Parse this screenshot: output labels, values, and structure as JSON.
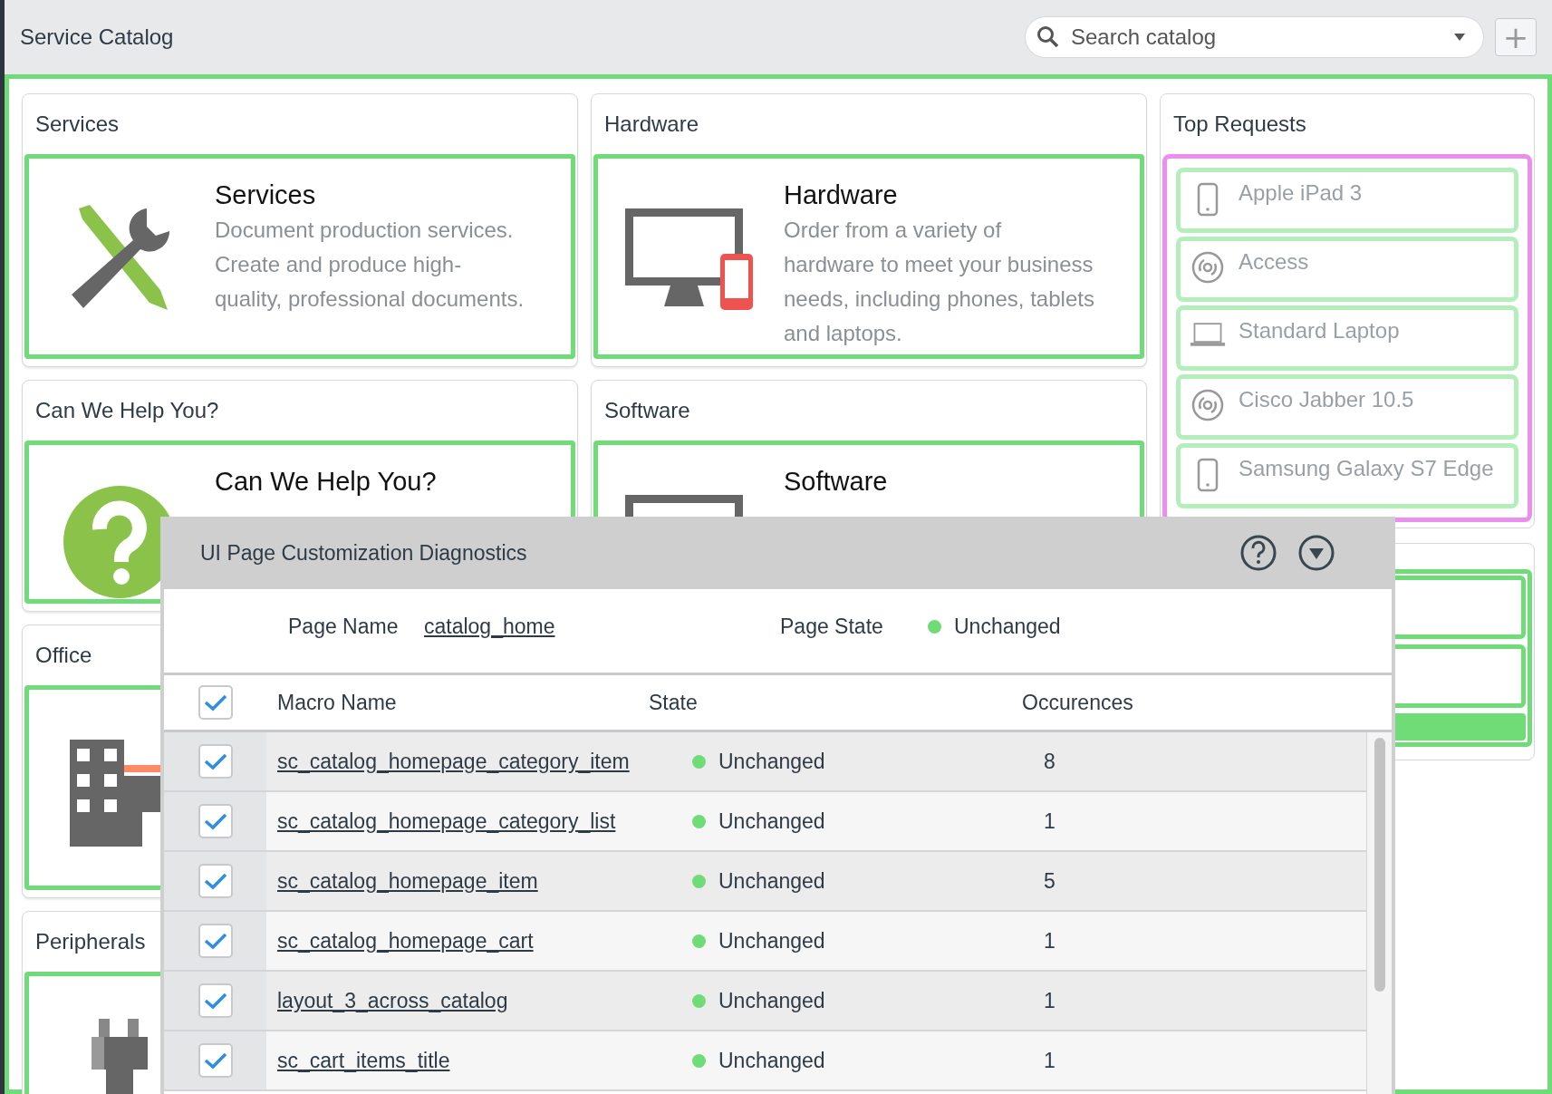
{
  "header": {
    "title": "Service Catalog",
    "search": {
      "placeholder": "Search catalog"
    },
    "add_button": "+"
  },
  "columns": [
    {
      "cards": [
        {
          "heading": "Services",
          "title": "Services",
          "description": "Document production services. Create and produce high-quality, professional documents.",
          "kind": "tools"
        },
        {
          "heading": "Can We Help You?",
          "title": "Can We Help You?",
          "kind": "help"
        },
        {
          "heading": "Office",
          "kind": "building"
        },
        {
          "heading": "Peripherals",
          "kind": "plug"
        }
      ]
    },
    {
      "cards": [
        {
          "heading": "Hardware",
          "title": "Hardware",
          "description": "Order from a variety of hardware to meet your business needs, including phones, tablets and laptops.",
          "kind": "devices"
        },
        {
          "heading": "Software",
          "title": "Software",
          "kind": "monitor"
        }
      ]
    }
  ],
  "top_requests": {
    "heading": "Top Requests",
    "items": [
      {
        "label": "Apple iPad 3",
        "kind": "phone"
      },
      {
        "label": "Access",
        "kind": "disc"
      },
      {
        "label": "Standard Laptop",
        "kind": "laptop"
      },
      {
        "label": "Cisco Jabber 10.5",
        "kind": "disc"
      },
      {
        "label": "Samsung Galaxy S7 Edge",
        "kind": "phone"
      }
    ]
  },
  "diagnostics": {
    "title": "UI Page Customization Diagnostics",
    "page_name_label": "Page Name",
    "page_name": "catalog_home",
    "page_state_label": "Page State",
    "page_state": {
      "label": "Unchanged",
      "color": "#6fdc78"
    },
    "columns": {
      "all_checked": true,
      "macro": "Macro Name",
      "state": "State",
      "occurrences": "Occurences"
    },
    "rows": [
      {
        "checked": true,
        "name": "sc_catalog_homepage_category_item",
        "state": "Unchanged",
        "color": "#6fdc78",
        "occurrences": "8"
      },
      {
        "checked": true,
        "name": "sc_catalog_homepage_category_list",
        "state": "Unchanged",
        "color": "#6fdc78",
        "occurrences": "1"
      },
      {
        "checked": true,
        "name": "sc_catalog_homepage_item",
        "state": "Unchanged",
        "color": "#6fdc78",
        "occurrences": "5"
      },
      {
        "checked": true,
        "name": "sc_catalog_homepage_cart",
        "state": "Unchanged",
        "color": "#6fdc78",
        "occurrences": "1"
      },
      {
        "checked": true,
        "name": "layout_3_across_catalog",
        "state": "Unchanged",
        "color": "#6fdc78",
        "occurrences": "1"
      },
      {
        "checked": true,
        "name": "sc_cart_items_title",
        "state": "Unchanged",
        "color": "#6fdc78",
        "occurrences": "1"
      }
    ]
  }
}
